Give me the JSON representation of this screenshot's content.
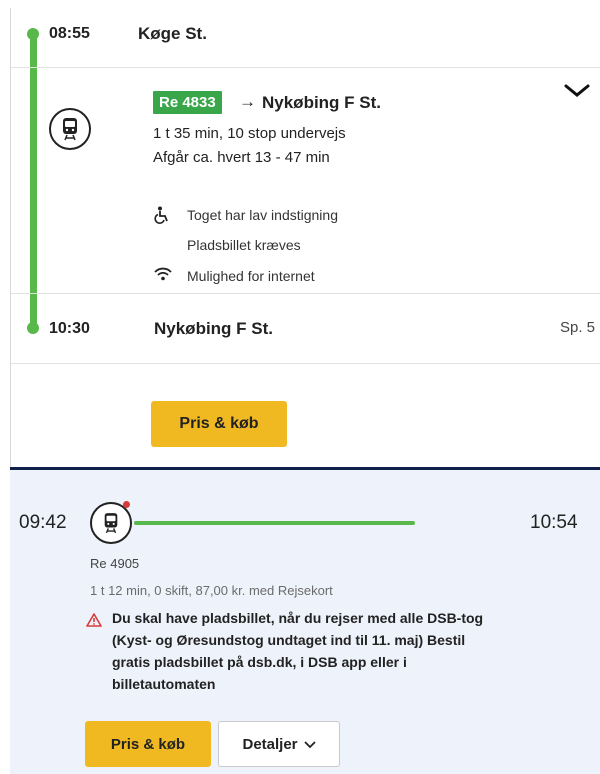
{
  "leg": {
    "departure": {
      "time": "08:55",
      "station": "Køge St."
    },
    "train": {
      "badge": "Re 4833",
      "arrow": "→",
      "destination": "Nykøbing F St.",
      "duration_stops": "1 t 35 min, 10 stop undervejs",
      "frequency": "Afgår ca. hvert 13 - 47 min"
    },
    "features": [
      {
        "icon": "wheelchair-icon",
        "text": "Toget har lav indstigning"
      },
      {
        "icon": "",
        "text": "Pladsbillet kræves"
      },
      {
        "icon": "wifi-icon",
        "text": "Mulighed for internet"
      }
    ],
    "arrival": {
      "time": "10:30",
      "station": "Nykøbing F St.",
      "platform": "Sp. 5"
    },
    "buy_label": "Pris & køb"
  },
  "journey2": {
    "departure_time": "09:42",
    "arrival_time": "10:54",
    "train_label": "Re 4905",
    "summary": "1 t 12 min, 0 skift, 87,00 kr. med Rejsekort",
    "warning_lines": [
      "Du skal have pladsbillet, når du rejser med alle DSB-tog",
      "(Kyst- og Øresundstog undtaget ind til 11. maj) Bestil",
      "gratis pladsbillet på dsb.dk, i DSB app eller i",
      "billetautomaten"
    ],
    "buy_label": "Pris & køb",
    "details_label": "Detaljer"
  },
  "colors": {
    "route_green": "#59b84a",
    "badge_green": "#3aa64a",
    "button_yellow": "#f0b922",
    "navy_divider": "#10204a",
    "card_blue": "#eef3fb",
    "warning_red": "#d63a3a"
  }
}
